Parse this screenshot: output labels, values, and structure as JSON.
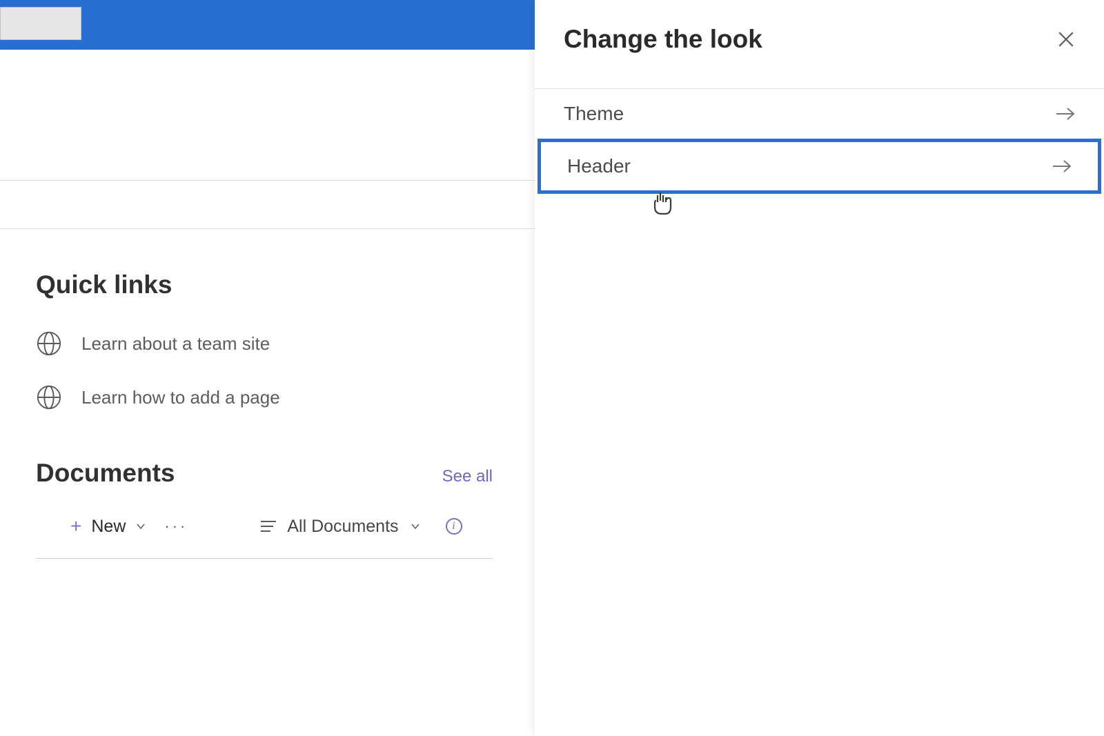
{
  "panel": {
    "title": "Change the look",
    "options": [
      {
        "label": "Theme",
        "highlighted": false
      },
      {
        "label": "Header",
        "highlighted": true
      }
    ]
  },
  "quickLinks": {
    "title": "Quick links",
    "items": [
      {
        "label": "Learn about a team site"
      },
      {
        "label": "Learn how to add a page"
      }
    ]
  },
  "documents": {
    "title": "Documents",
    "seeAll": "See all",
    "newLabel": "New",
    "viewLabel": "All Documents"
  }
}
